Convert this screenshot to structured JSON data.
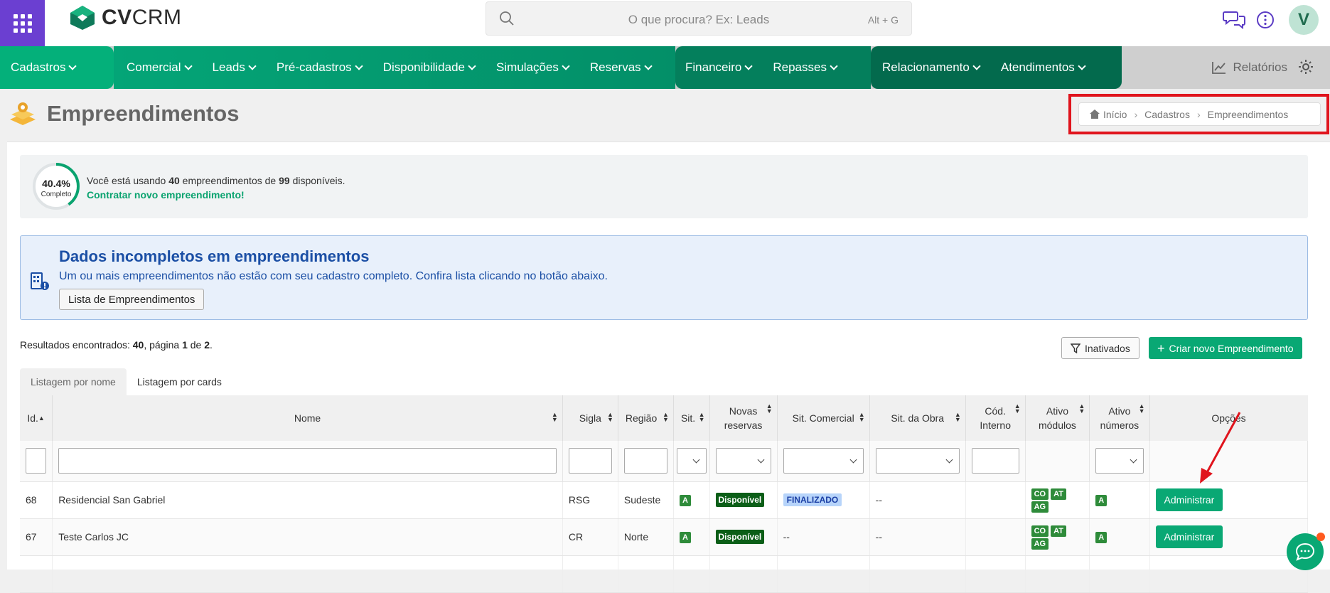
{
  "app": {
    "logo_text_bold": "CV",
    "logo_text_light": "CRM",
    "avatar_letter": "V"
  },
  "search": {
    "placeholder": "O que procura? Ex: Leads",
    "shortcut": "Alt + G"
  },
  "nav": {
    "items": [
      "Cadastros",
      "Comercial",
      "Leads",
      "Pré-cadastros",
      "Disponibilidade",
      "Simulações",
      "Reservas",
      "Financeiro",
      "Repasses",
      "Relacionamento",
      "Atendimentos"
    ],
    "reports_label": "Relatórios"
  },
  "page": {
    "title": "Empreendimentos"
  },
  "breadcrumb": [
    "Início",
    "Cadastros",
    "Empreendimentos"
  ],
  "usage": {
    "percent_label": "40.4%",
    "percent_value": 0.404,
    "complete_label": "Completo",
    "text_prefix": "Você está usando",
    "used": "40",
    "text_middle": "empreendimentos de",
    "total": "99",
    "text_suffix": "disponíveis.",
    "link": "Contratar novo empreendimento!"
  },
  "alert": {
    "title": "Dados incompletos em empreendimentos",
    "message": "Um ou mais empreendimentos não estão com seu cadastro completo. Confira lista clicando no botão abaixo.",
    "button": "Lista de Empreendimentos"
  },
  "results": {
    "prefix": "Resultados encontrados:",
    "count": "40",
    "page_label": ", página",
    "page": "1",
    "of_label": "de",
    "pages": "2",
    "end": "."
  },
  "actions": {
    "inactivated": "Inativados",
    "create": "Criar novo Empreendimento"
  },
  "tabs": [
    "Listagem por nome",
    "Listagem por cards"
  ],
  "table": {
    "columns": [
      "Id.",
      "Nome",
      "Sigla",
      "Região",
      "Sit.",
      "Novas reservas",
      "Sit. Comercial",
      "Sit. da Obra",
      "Cód. Interno",
      "Ativo módulos",
      "Ativo números",
      "Opções"
    ],
    "rows": [
      {
        "id": "68",
        "nome": "Residencial San Gabriel",
        "sigla": "RSG",
        "regiao": "Sudeste",
        "sit": "A",
        "novas": "Disponível",
        "sit_comercial": "FINALIZADO",
        "sit_obra": "--",
        "cod": "",
        "modulos": [
          "CO",
          "AT",
          "AG"
        ],
        "numeros": "A",
        "opcao": "Administrar"
      },
      {
        "id": "67",
        "nome": "Teste Carlos JC",
        "sigla": "CR",
        "regiao": "Norte",
        "sit": "A",
        "novas": "Disponível",
        "sit_comercial": "--",
        "sit_obra": "--",
        "cod": "",
        "modulos": [
          "CO",
          "AT",
          "AG"
        ],
        "numeros": "A",
        "opcao": "Administrar"
      }
    ]
  }
}
